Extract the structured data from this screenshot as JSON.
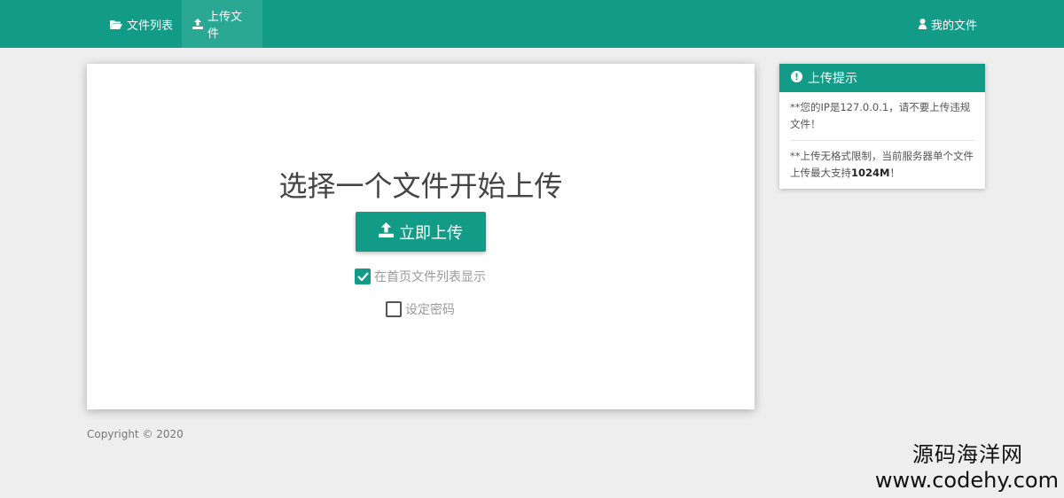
{
  "nav": {
    "file_list": "文件列表",
    "upload_file": "上传文件",
    "my_files": "我的文件"
  },
  "main": {
    "title": "选择一个文件开始上传",
    "upload_button": "立即上传",
    "show_on_homepage": {
      "label": "在首页文件列表显示",
      "checked": true
    },
    "set_password": {
      "label": "设定密码",
      "checked": false
    }
  },
  "tips": {
    "header": "上传提示",
    "ip_notice_prefix": "**您的IP是127.0.0.1，请不要上传违规文件！",
    "limit_prefix": "**上传无格式限制，当前服务器单个文件上传最大支持",
    "limit_value": "1024M",
    "limit_suffix": "！"
  },
  "footer": {
    "copyright": "Copyright © 2020"
  },
  "watermark": {
    "name": "源码海洋网",
    "url": "www.codehy.com"
  },
  "colors": {
    "brand": "#129c87",
    "background": "#eeeeee"
  },
  "icons": {
    "file_list": "folder-open-icon",
    "upload": "upload-icon",
    "my_files": "user-icon",
    "tip": "exclamation-circle-icon",
    "checkbox": "check-icon"
  }
}
